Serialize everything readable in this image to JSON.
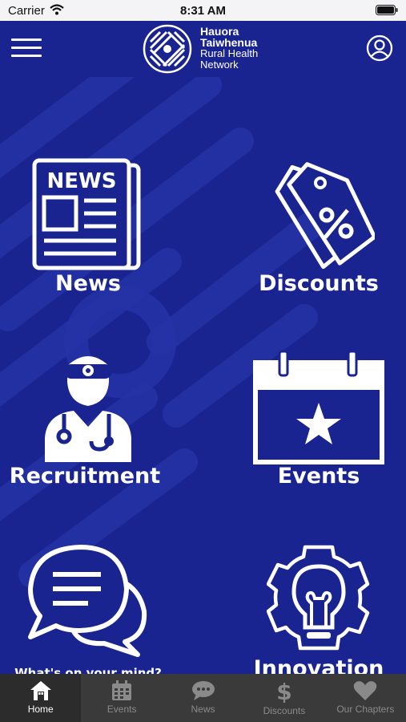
{
  "status_bar": {
    "carrier": "Carrier",
    "time": "8:31 AM"
  },
  "header": {
    "logo_line1": "Hauora",
    "logo_line2": "Taiwhenua",
    "logo_line3": "Rural Health",
    "logo_line4": "Network",
    "menu_icon": "hamburger-menu-icon",
    "profile_icon": "user-profile-icon"
  },
  "tiles": [
    {
      "label": "News",
      "icon": "newspaper-icon"
    },
    {
      "label": "Discounts",
      "icon": "price-tag-percent-icon"
    },
    {
      "label": "Recruitment",
      "icon": "doctor-icon"
    },
    {
      "label": "Events",
      "icon": "calendar-star-icon"
    },
    {
      "label": "What's on your mind?",
      "icon": "chat-bubbles-icon"
    },
    {
      "label": "Innovation",
      "icon": "lightbulb-gear-icon"
    }
  ],
  "tab_bar": {
    "items": [
      {
        "label": "Home",
        "icon": "home-icon",
        "active": true
      },
      {
        "label": "Events",
        "icon": "calendar-icon",
        "active": false
      },
      {
        "label": "News",
        "icon": "chat-bubble-icon",
        "active": false
      },
      {
        "label": "Discounts",
        "icon": "dollar-icon",
        "active": false
      },
      {
        "label": "Our Chapters",
        "icon": "heart-icon",
        "active": false
      }
    ]
  },
  "colors": {
    "background": "#1a2491",
    "tab_bar": "#3a3a3a",
    "tab_inactive": "#8a8a8a",
    "tab_active": "#ffffff"
  }
}
